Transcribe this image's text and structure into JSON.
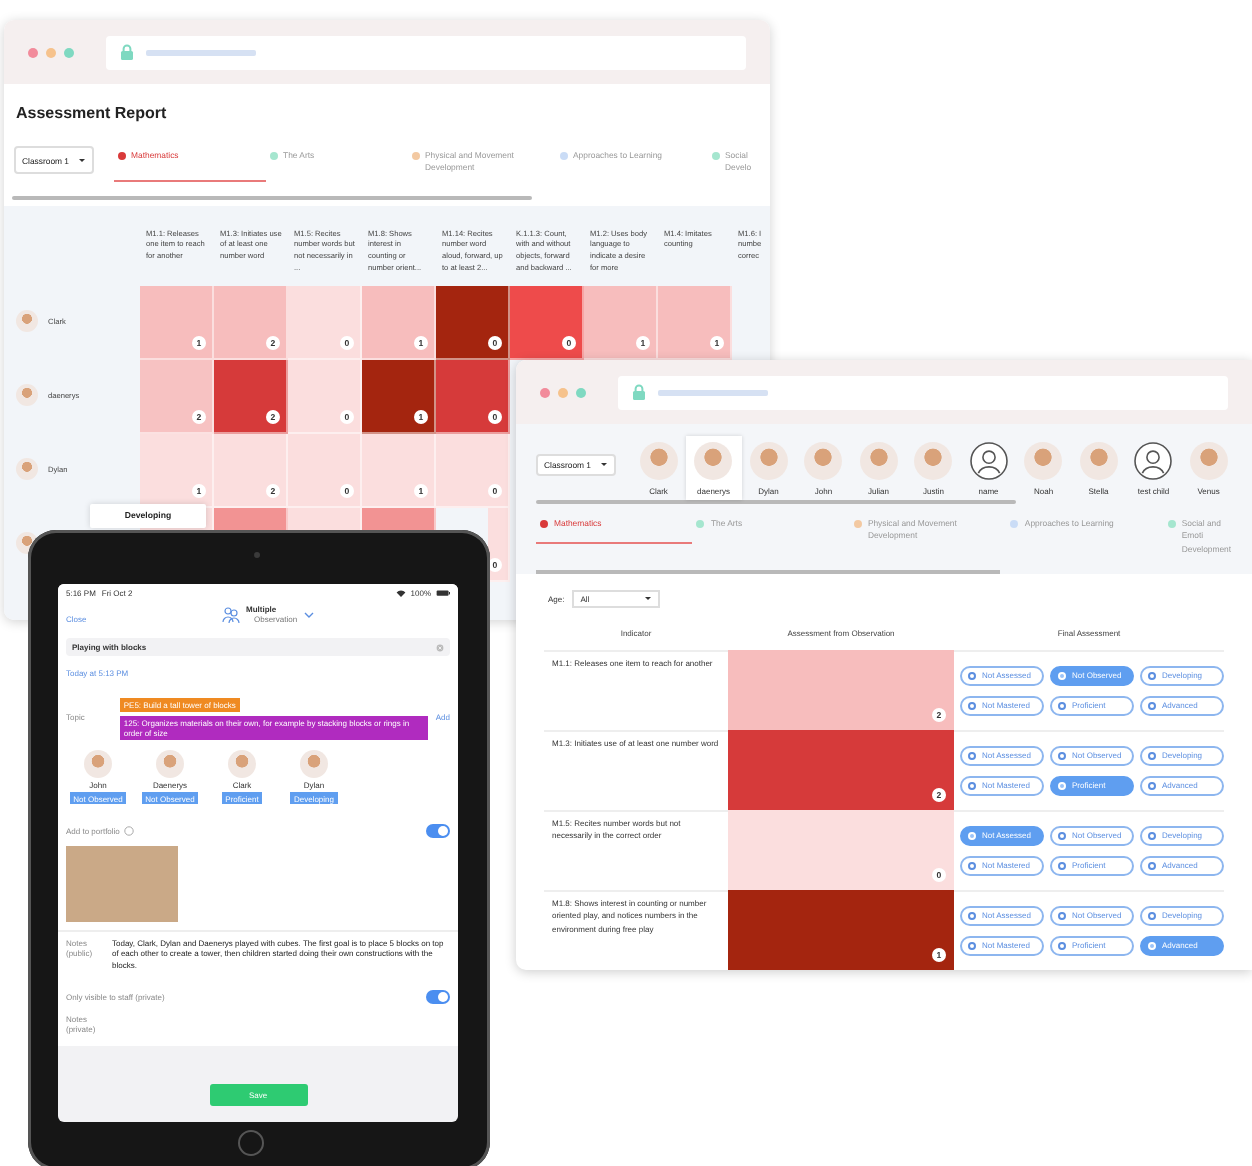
{
  "report": {
    "title": "Assessment Report",
    "classroom": "Classroom 1",
    "tabs": [
      {
        "label": "Mathematics",
        "color": "#d93a3a",
        "selected": true
      },
      {
        "label": "The Arts",
        "color": "#a5e6cf",
        "selected": false
      },
      {
        "label": "Physical and Movement Development",
        "color": "#f3c9a2",
        "selected": false
      },
      {
        "label": "Approaches to Learning",
        "color": "#cadcf6",
        "selected": false
      },
      {
        "label": "Social Develo",
        "color": "#a5e6cf",
        "selected": false
      }
    ],
    "columns": [
      "M1.1: Releases one item to reach for another",
      "M1.3: Initiates use of at least one number word",
      "M1.5: Recites number words but not necessarily in ...",
      "M1.8: Shows interest in counting or number orient...",
      "M1.14: Recites number word aloud, forward, up to at least 2...",
      "K.1.1.3: Count, with and without objects, forward and backward ...",
      "M1.2: Uses body language to indicate a desire for more",
      "M1.4: Imitates counting",
      "M1.6: I numbe correc"
    ],
    "rows": [
      {
        "name": "Clark",
        "cells": [
          {
            "value": "1",
            "color": "#f7bdbd"
          },
          {
            "value": "2",
            "color": "#f7bdbd"
          },
          {
            "value": "0",
            "color": "#fbdede"
          },
          {
            "value": "1",
            "color": "#f7bdbd"
          },
          {
            "value": "0",
            "color": "#a4250f"
          },
          {
            "value": "0",
            "color": "#ee4b4b"
          },
          {
            "value": "1",
            "color": "#f7bdbd"
          },
          {
            "value": "1",
            "color": "#f7bdbd"
          }
        ]
      },
      {
        "name": "daenerys",
        "cells": [
          {
            "value": "2",
            "color": "#f7c2c2"
          },
          {
            "value": "2",
            "color": "#d63a3a"
          },
          {
            "value": "0",
            "color": "#fbdede"
          },
          {
            "value": "1",
            "color": "#a4250f"
          },
          {
            "value": "0",
            "color": "#d63a3a"
          }
        ]
      },
      {
        "name": "Dylan",
        "cells": [
          {
            "value": "1",
            "color": "#fbdede"
          },
          {
            "value": "2",
            "color": "#fbdede"
          },
          {
            "value": "0",
            "color": "#fbdede"
          },
          {
            "value": "1",
            "color": "#fbdede"
          },
          {
            "value": "0",
            "color": "#fbdede"
          }
        ]
      },
      {
        "cells": [
          {
            "color": "#fbdede"
          },
          {
            "color": "#f29393"
          },
          {
            "color": "#fbdede"
          },
          {
            "color": "#f29393"
          },
          {
            "value": "0",
            "color": "#fbdede"
          }
        ]
      }
    ],
    "tooltip": "Developing"
  },
  "assessment": {
    "classroom": "Classroom 1",
    "children": [
      {
        "name": "Clark",
        "kind": "photo",
        "selected": false
      },
      {
        "name": "daenerys",
        "kind": "photo",
        "selected": true
      },
      {
        "name": "Dylan",
        "kind": "photo",
        "selected": false
      },
      {
        "name": "John",
        "kind": "photo",
        "selected": false
      },
      {
        "name": "Julian",
        "kind": "photo",
        "selected": false
      },
      {
        "name": "Justin",
        "kind": "photo",
        "selected": false
      },
      {
        "name": "name",
        "kind": "generic",
        "selected": false
      },
      {
        "name": "Noah",
        "kind": "photo",
        "selected": false
      },
      {
        "name": "Stella",
        "kind": "photo",
        "selected": false
      },
      {
        "name": "test child",
        "kind": "generic",
        "selected": false
      },
      {
        "name": "Venus",
        "kind": "photo",
        "selected": false
      }
    ],
    "tabs": [
      {
        "label": "Mathematics",
        "color": "#d93a3a",
        "selected": true
      },
      {
        "label": "The Arts",
        "color": "#a5e6cf",
        "selected": false
      },
      {
        "label": "Physical and Movement Development",
        "color": "#f3c9a2",
        "selected": false
      },
      {
        "label": "Approaches to Learning",
        "color": "#cadcf6",
        "selected": false
      },
      {
        "label": "Social and Emoti Development",
        "color": "#a5e6cf",
        "selected": false
      }
    ],
    "age_label": "Age:",
    "age": "All",
    "columns": [
      "Indicator",
      "Assessment from Observation",
      "Final Assessment"
    ],
    "rows": [
      {
        "indicator": "M1.1: Releases one item to reach for another",
        "value": "2",
        "color": "#f7bdbd",
        "options": [
          {
            "label": "Not Assessed",
            "selected": false
          },
          {
            "label": "Not Observed",
            "selected": true
          },
          {
            "label": "Developing",
            "selected": false
          },
          {
            "label": "Not Mastered",
            "selected": false
          },
          {
            "label": "Proficient",
            "selected": false
          },
          {
            "label": "Advanced",
            "selected": false
          }
        ]
      },
      {
        "indicator": "M1.3: Initiates use of at least one number word",
        "value": "2",
        "color": "#d63a3a",
        "options": [
          {
            "label": "Not Assessed",
            "selected": false
          },
          {
            "label": "Not Observed",
            "selected": false
          },
          {
            "label": "Developing",
            "selected": false
          },
          {
            "label": "Not Mastered",
            "selected": false
          },
          {
            "label": "Proficient",
            "selected": true
          },
          {
            "label": "Advanced",
            "selected": false
          }
        ]
      },
      {
        "indicator": "M1.5: Recites number words but not necessarily in the correct order",
        "value": "0",
        "color": "#fbdede",
        "options": [
          {
            "label": "Not Assessed",
            "selected": true
          },
          {
            "label": "Not Observed",
            "selected": false
          },
          {
            "label": "Developing",
            "selected": false
          },
          {
            "label": "Not Mastered",
            "selected": false
          },
          {
            "label": "Proficient",
            "selected": false
          },
          {
            "label": "Advanced",
            "selected": false
          }
        ]
      },
      {
        "indicator": "M1.8: Shows interest in counting or number oriented play, and notices numbers in the environment during free play",
        "value": "1",
        "color": "#a4250f",
        "options": [
          {
            "label": "Not Assessed",
            "selected": false
          },
          {
            "label": "Not Observed",
            "selected": false
          },
          {
            "label": "Developing",
            "selected": false
          },
          {
            "label": "Not Mastered",
            "selected": false
          },
          {
            "label": "Proficient",
            "selected": false
          },
          {
            "label": "Advanced",
            "selected": true
          }
        ]
      }
    ]
  },
  "tablet": {
    "time": "5:16 PM",
    "date": "Fri Oct 2",
    "battery": "100%",
    "close": "Close",
    "mode": "Multiple",
    "mode_sub": "Observation",
    "title_field": "Playing with blocks",
    "when": "Today at 5:13 PM",
    "topic_label": "Topic",
    "add": "Add",
    "topics": [
      {
        "label": "PE5: Build a tall tower of blocks",
        "color": "#ef8a22"
      },
      {
        "label": "125: Organizes materials on their own, for example by stacking blocks or rings in order of size",
        "color": "#b02bbf"
      }
    ],
    "children": [
      {
        "name": "John",
        "status": "Not Observed"
      },
      {
        "name": "Daenerys",
        "status": "Not Observed"
      },
      {
        "name": "Clark",
        "status": "Proficient"
      },
      {
        "name": "Dylan",
        "status": "Developing"
      }
    ],
    "portfolio": {
      "label": "Add to portfolio",
      "on": true
    },
    "notes_public": {
      "label": "Notes (public)",
      "text": "Today, Clark, Dylan and Daenerys played with cubes. The first goal is to place 5 blocks on top of each other to create a tower, then children started doing their own constructions with the blocks."
    },
    "private": {
      "label": "Only visible to staff (private)",
      "on": true
    },
    "notes_private": "Notes (private)",
    "save": "Save"
  }
}
